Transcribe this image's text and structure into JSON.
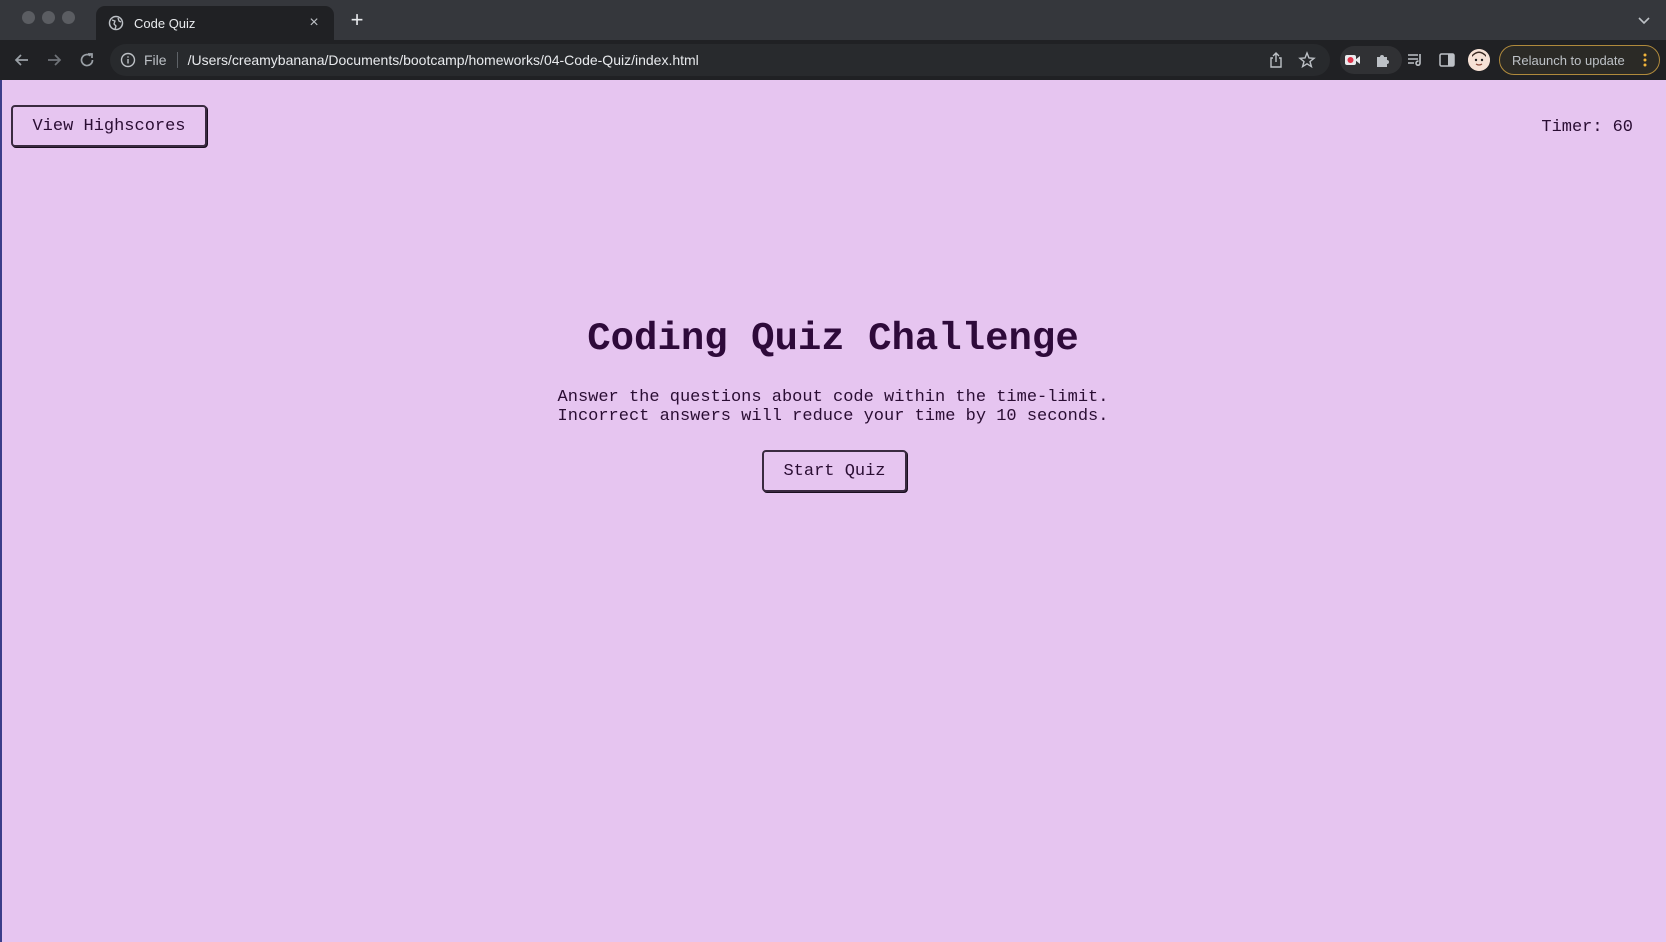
{
  "browser": {
    "tab_title": "Code Quiz",
    "tab_close": "×",
    "new_tab": "+",
    "scheme": "File",
    "url": "/Users/creamybanana/Documents/bootcamp/homeworks/04-Code-Quiz/index.html",
    "relaunch_label": "Relaunch to update"
  },
  "header": {
    "highscores_label": "View Highscores",
    "timer_label": "Timer:",
    "timer_value": "60"
  },
  "main": {
    "title": "Coding Quiz Challenge",
    "description_line1": "Answer the questions about code within the time-limit.",
    "description_line2": "Incorrect answers will reduce your time by 10 seconds.",
    "start_label": "Start Quiz"
  },
  "colors": {
    "page_background": "#e6c5f0",
    "text": "#2a0d33",
    "chrome_dark": "#202124",
    "relaunch_border": "#b08a3c"
  }
}
